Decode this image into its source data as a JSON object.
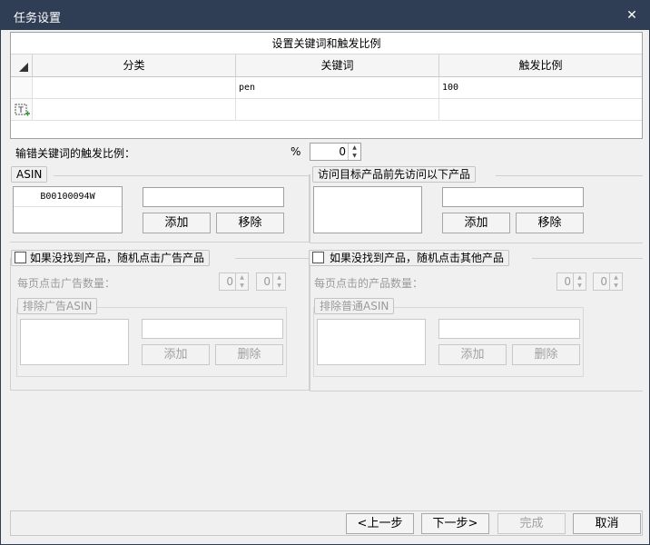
{
  "window": {
    "title": "任务设置",
    "close_symbol": "✕"
  },
  "keyword_table": {
    "caption": "设置关键词和触发比例",
    "columns": [
      "分类",
      "关键词",
      "触发比例"
    ],
    "rows": [
      {
        "category": "",
        "keyword": "pen",
        "ratio": "100"
      }
    ],
    "new_row_icon": "T"
  },
  "misspell": {
    "label": "输错关键词的触发比例：",
    "unit": "%",
    "value": "0"
  },
  "asin_group": {
    "legend": "ASIN",
    "items": [
      "B00100094W"
    ],
    "input_value": "",
    "add_label": "添加",
    "remove_label": "移除"
  },
  "visit_group": {
    "legend": "访问目标产品前先访问以下产品",
    "input_value": "",
    "add_label": "添加",
    "remove_label": "移除"
  },
  "ad_group": {
    "checkbox_label": "如果没找到产品，随机点击广告产品",
    "count_label": "每页点击广告数量：",
    "min_value": "0",
    "max_value": "0",
    "exclude_legend": "排除广告ASIN",
    "add_label": "添加",
    "delete_label": "删除"
  },
  "other_group": {
    "checkbox_label": "如果没找到产品，随机点击其他产品",
    "count_label": "每页点击的产品数量：",
    "min_value": "0",
    "max_value": "0",
    "exclude_legend": "排除普通ASIN",
    "add_label": "添加",
    "delete_label": "删除"
  },
  "footer": {
    "prev_label": "<上一步",
    "next_label": "下一步>",
    "finish_label": "完成",
    "cancel_label": "取消"
  },
  "colors": {
    "titlebar": "#2f3e54",
    "background": "#f0f0f0",
    "disabled_text": "#9a9a9a"
  }
}
